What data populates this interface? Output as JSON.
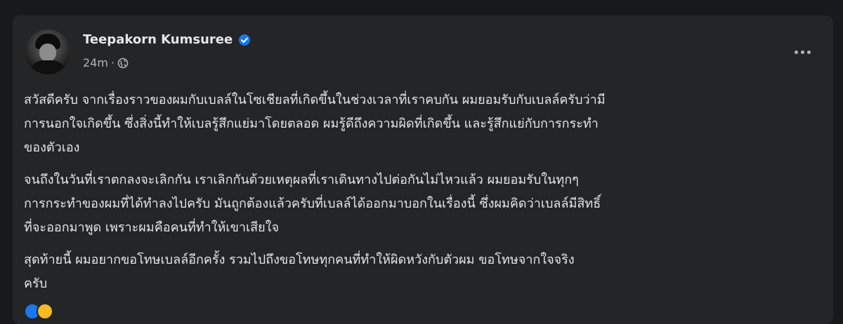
{
  "post": {
    "author": "Teepakorn Kumsuree",
    "time": "24m",
    "separator": "·",
    "paragraphs": [
      {
        "lines": [
          "สวัสดีครับ จากเรื่องราวของผมกับเบลล์ในโซเชียลที่เกิดขึ้นในช่วงเวลาที่เราคบกัน ผมยอมรับกับเบลล์ครับว่ามี",
          "การนอกใจเกิดขึ้น ซึ่งสิ่งนี้ทำให้เบลรู้สึกแย่มาโดยตลอด ผมรู้ดีถึงความผิดที่เกิดขึ้น และรู้สึกแย่กับการกระทำ",
          "ของตัวเอง"
        ]
      },
      {
        "lines": [
          "จนถึงในวันที่เราตกลงจะเลิกกัน เราเลิกกันด้วยเหตุผลที่เราเดินทางไปต่อกันไม่ไหวแล้ว ผมยอมรับในทุกๆ",
          "การกระทำของผมที่ได้ทำลงไปครับ มันถูกต้องแล้วครับที่เบลล์ได้ออกมาบอกในเรื่องนี้ ซึ่งผมคิดว่าเบลล์มีสิทธิ์",
          "ที่จะออกมาพูด เพราะผมคือคนที่ทำให้เขาเสียใจ"
        ]
      },
      {
        "lines": [
          "สุดท้ายนี้ ผมอยากขอโทษเบลล์อีกครั้ง รวมไปถึงขอโทษทุกคนที่ทำให้ผิดหวังกับตัวผม ขอโทษจากใจจริง",
          "ครับ"
        ]
      }
    ]
  },
  "icons": {
    "verified": "verified-badge-icon",
    "privacy": "globe-icon",
    "more": "more-options-icon"
  },
  "colors": {
    "background": "#18191a",
    "card": "#242526",
    "text_primary": "#e4e6eb",
    "text_secondary": "#b0b3b8",
    "verified_blue": "#1877f2"
  }
}
